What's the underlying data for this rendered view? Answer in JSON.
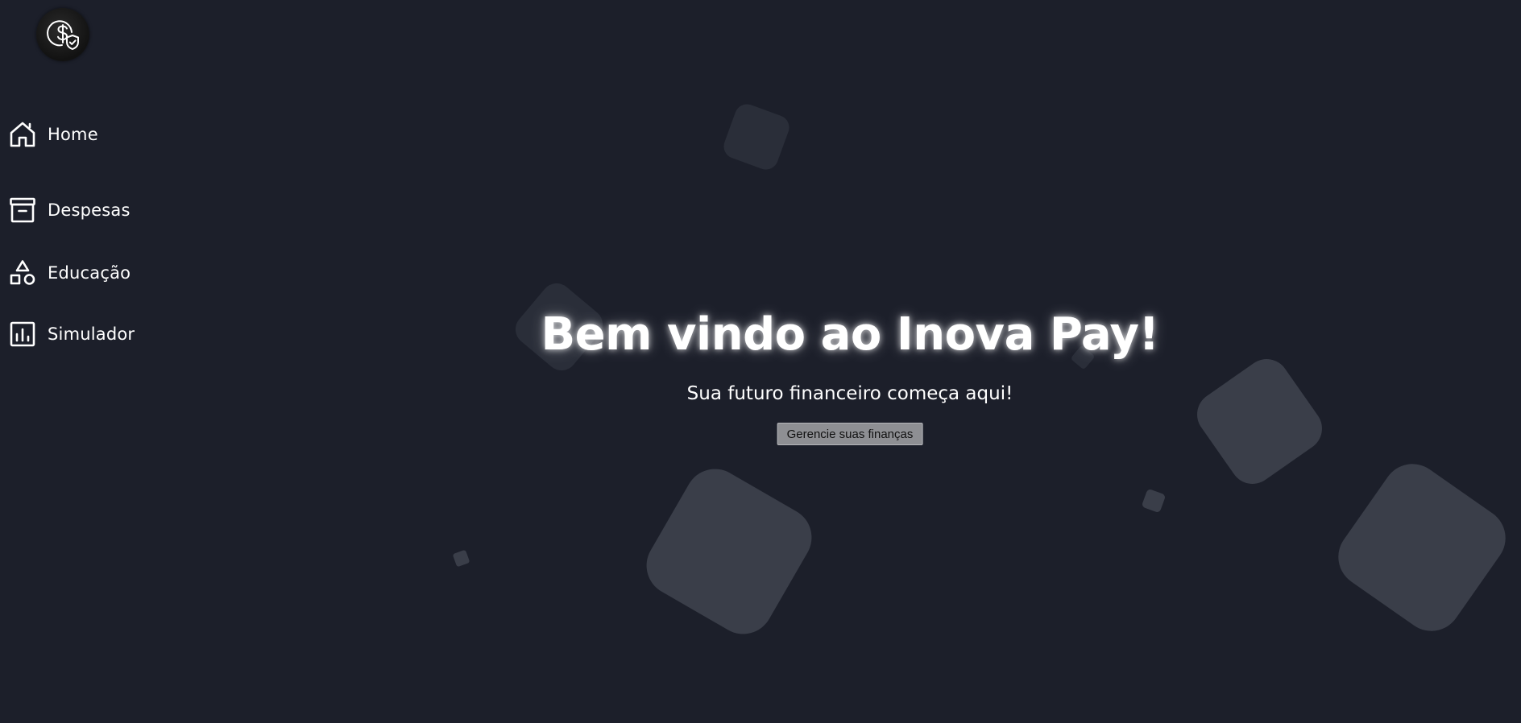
{
  "app": {
    "logo_icon": "dollar-shield-icon"
  },
  "sidebar": {
    "items": [
      {
        "label": "Home",
        "icon": "home-icon"
      },
      {
        "label": "Despesas",
        "icon": "archive-box-icon"
      },
      {
        "label": "Educação",
        "icon": "shapes-icon"
      },
      {
        "label": "Simulador",
        "icon": "bar-chart-icon"
      }
    ]
  },
  "hero": {
    "title": "Bem vindo ao Inova Pay!",
    "subtitle": "Sua futuro financeiro começa aqui!",
    "button_label": "Gerencie suas finanças"
  },
  "colors": {
    "background": "#1c1f2a",
    "decor_shape": "#3a3e49",
    "button_bg": "#8e8f93",
    "text": "#ffffff"
  }
}
